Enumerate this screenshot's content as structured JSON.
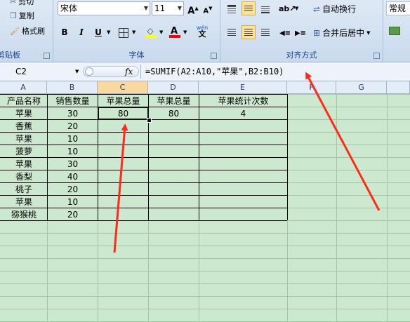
{
  "ribbon": {
    "clipboard": {
      "cut_label": "剪切",
      "copy_label": "复制",
      "format_painter_label": "格式刷",
      "group_label": "剪贴板"
    },
    "font": {
      "font_name": "宋体",
      "font_size": "11",
      "group_label": "字体",
      "bold": "B",
      "italic": "I",
      "underline": "U",
      "grow": "A",
      "shrink": "A",
      "phonetic": "wén"
    },
    "alignment": {
      "wrap_text_label": "自动换行",
      "merge_center_label": "合并后居中",
      "group_label": "对齐方式"
    },
    "number": {
      "format_label": "常规"
    }
  },
  "formula_bar": {
    "name_box": "C2",
    "fx_label": "fx",
    "formula": "=SUMIF(A2:A10,\"苹果\",B2:B10)"
  },
  "columns": [
    "A",
    "B",
    "C",
    "D",
    "E",
    "F",
    "G"
  ],
  "active_column": "C",
  "sheet": {
    "headers": [
      "产品名称",
      "销售数量",
      "苹果总量",
      "苹果总量",
      "苹果统计次数"
    ],
    "rows": [
      [
        "苹果",
        "30",
        "80",
        "80",
        "4"
      ],
      [
        "香蕉",
        "20",
        "",
        "",
        ""
      ],
      [
        "苹果",
        "10",
        "",
        "",
        ""
      ],
      [
        "菠萝",
        "10",
        "",
        "",
        ""
      ],
      [
        "苹果",
        "30",
        "",
        "",
        ""
      ],
      [
        "香梨",
        "40",
        "",
        "",
        ""
      ],
      [
        "桃子",
        "20",
        "",
        "",
        ""
      ],
      [
        "苹果",
        "10",
        "",
        "",
        ""
      ],
      [
        "猕猴桃",
        "20",
        "",
        "",
        ""
      ]
    ]
  },
  "colors": {
    "sheet_background": "#cce8cf",
    "arrow": "#ff2a1a",
    "active_header": "#f9d99f"
  },
  "icons": [
    "cut-icon",
    "copy-icon",
    "format-painter-icon",
    "borders-icon",
    "fill-color-icon",
    "font-color-icon",
    "wrap-text-icon",
    "merge-icon",
    "fx-icon"
  ]
}
